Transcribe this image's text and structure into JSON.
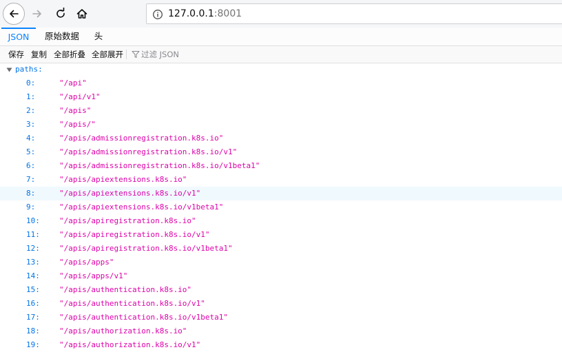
{
  "browser": {
    "url_host": "127.0.0.1",
    "url_port": ":8001"
  },
  "tabs": [
    {
      "label": "JSON",
      "active": true
    },
    {
      "label": "原始数据",
      "active": false
    },
    {
      "label": "头",
      "active": false
    }
  ],
  "toolbar": {
    "save_label": "保存",
    "copy_label": "复制",
    "collapse_all_label": "全部折叠",
    "expand_all_label": "全部展开",
    "filter_placeholder": "过滤 JSON"
  },
  "tree": {
    "root_key": "paths:",
    "highlighted_index": 8,
    "items": [
      {
        "key": "0:",
        "value": "\"/api\""
      },
      {
        "key": "1:",
        "value": "\"/api/v1\""
      },
      {
        "key": "2:",
        "value": "\"/apis\""
      },
      {
        "key": "3:",
        "value": "\"/apis/\""
      },
      {
        "key": "4:",
        "value": "\"/apis/admissionregistration.k8s.io\""
      },
      {
        "key": "5:",
        "value": "\"/apis/admissionregistration.k8s.io/v1\""
      },
      {
        "key": "6:",
        "value": "\"/apis/admissionregistration.k8s.io/v1beta1\""
      },
      {
        "key": "7:",
        "value": "\"/apis/apiextensions.k8s.io\""
      },
      {
        "key": "8:",
        "value": "\"/apis/apiextensions.k8s.io/v1\""
      },
      {
        "key": "9:",
        "value": "\"/apis/apiextensions.k8s.io/v1beta1\""
      },
      {
        "key": "10:",
        "value": "\"/apis/apiregistration.k8s.io\""
      },
      {
        "key": "11:",
        "value": "\"/apis/apiregistration.k8s.io/v1\""
      },
      {
        "key": "12:",
        "value": "\"/apis/apiregistration.k8s.io/v1beta1\""
      },
      {
        "key": "13:",
        "value": "\"/apis/apps\""
      },
      {
        "key": "14:",
        "value": "\"/apis/apps/v1\""
      },
      {
        "key": "15:",
        "value": "\"/apis/authentication.k8s.io\""
      },
      {
        "key": "16:",
        "value": "\"/apis/authentication.k8s.io/v1\""
      },
      {
        "key": "17:",
        "value": "\"/apis/authentication.k8s.io/v1beta1\""
      },
      {
        "key": "18:",
        "value": "\"/apis/authorization.k8s.io\""
      },
      {
        "key": "19:",
        "value": "\"/apis/authorization.k8s.io/v1\""
      }
    ]
  }
}
